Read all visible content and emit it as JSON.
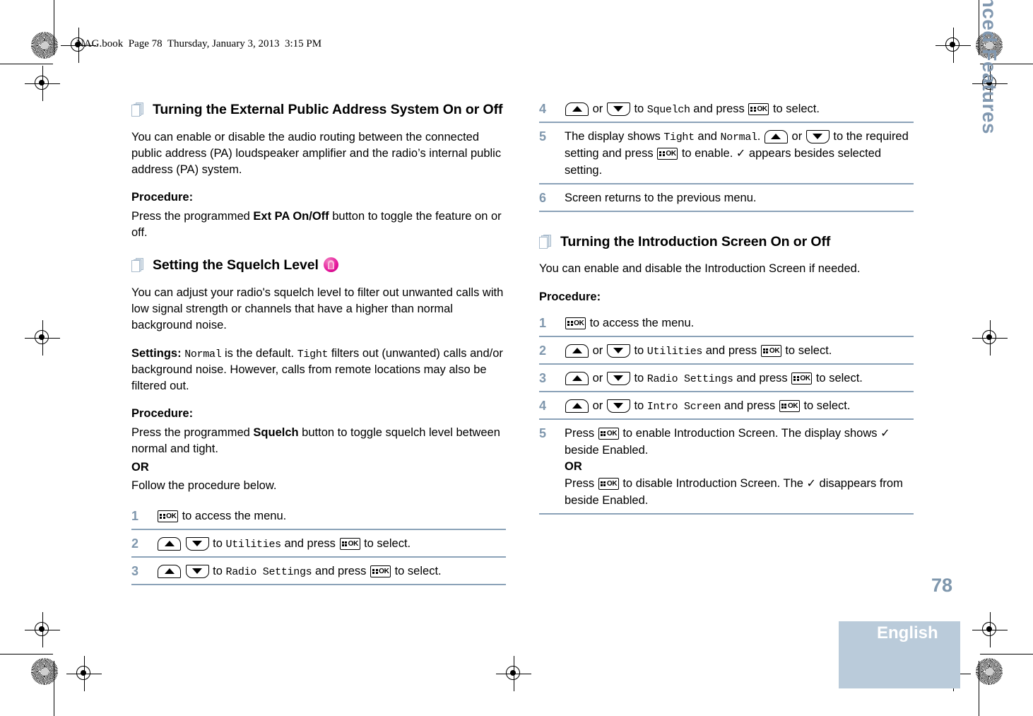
{
  "document": {
    "file_header": "NAG.book  Page 78  Thursday, January 3, 2013  3:15 PM",
    "page_number": "78",
    "language": "English",
    "chapter_tab": "Advanced Features"
  },
  "icons": {
    "pages": "pages-icon",
    "lock": "lock-icon",
    "ok_button": "ok-button-icon",
    "up_button": "up-arrow-button-icon",
    "down_button": "down-arrow-button-icon",
    "check": "✓"
  },
  "left_column": {
    "section1": {
      "heading": "Turning the External Public Address System On or Off",
      "intro": "You can enable or disable the audio routing between the connected public address (PA) loudspeaker amplifier and the radio’s internal public address (PA) system.",
      "procedure_label": "Procedure:",
      "procedure_pre": "Press the programmed ",
      "procedure_button": "Ext PA On/Off",
      "procedure_post": " button to toggle the feature on or off."
    },
    "section2": {
      "heading": "Setting the Squelch Level",
      "intro": "You can adjust your radio's squelch level to filter out unwanted calls with low signal strength or channels that have a higher than normal background noise.",
      "settings_label": "Settings:",
      "settings_t1": " ",
      "settings_mono1": "Normal",
      "settings_t2": " is the default. ",
      "settings_mono2": "Tight",
      "settings_t3": " filters out (unwanted) calls and/or background noise. However, calls from remote locations may also be filtered out.",
      "procedure_label": "Procedure:",
      "procedure_pre": "Press the programmed ",
      "procedure_button": "Squelch",
      "procedure_post": " button to toggle squelch level between normal and tight.",
      "or_label": "OR",
      "follow_text": "Follow the procedure below.",
      "steps": [
        {
          "num": "1",
          "pre": "",
          "post": " to access the menu.",
          "kind": "ok-then-text"
        },
        {
          "num": "2",
          "mid": " to ",
          "menu": "Utilities",
          "after": " and press ",
          "tail": " to select.",
          "kind": "arrows-menu-ok"
        },
        {
          "num": "3",
          "mid": " to ",
          "menu": "Radio Settings",
          "after": " and press ",
          "tail": " to select.",
          "kind": "arrows-menu-ok"
        }
      ],
      "or_word": "or"
    }
  },
  "right_column": {
    "continued_steps": [
      {
        "num": "4",
        "mid": " to ",
        "menu": "Squelch",
        "after": " and press ",
        "tail": " to select.",
        "kind": "arrows-menu-ok"
      },
      {
        "num": "5",
        "kind": "step5-display",
        "t1": "The display shows ",
        "m1": "Tight",
        "t2": " and ",
        "m2": "Normal",
        "t3": ". ",
        "t4": " to the required setting and press ",
        "t5": " to enable. ",
        "t6": " appears besides selected setting."
      },
      {
        "num": "6",
        "kind": "plain",
        "text": "Screen returns to the previous menu."
      }
    ],
    "section3": {
      "heading": "Turning the Introduction Screen On or Off",
      "intro": "You can enable and disable the Introduction Screen if needed.",
      "procedure_label": "Procedure:",
      "steps": [
        {
          "num": "1",
          "pre": "",
          "post": " to access the menu.",
          "kind": "ok-then-text"
        },
        {
          "num": "2",
          "mid": " to ",
          "menu": "Utilities",
          "after": " and press ",
          "tail": " to select.",
          "kind": "arrows-menu-ok"
        },
        {
          "num": "3",
          "mid": " to ",
          "menu": "Radio Settings",
          "after": " and press ",
          "tail": " to select.",
          "kind": "arrows-menu-ok"
        },
        {
          "num": "4",
          "mid": " to ",
          "menu": "Intro Screen",
          "after": " and press ",
          "tail": " to select.",
          "kind": "arrows-menu-ok"
        },
        {
          "num": "5",
          "kind": "step5-intro",
          "t1": "Press ",
          "t2": " to enable Introduction Screen. The display shows ",
          "t3": " beside Enabled.",
          "or_label": "OR",
          "t4": "Press ",
          "t5": " to disable Introduction Screen. The ",
          "t6": " disappears from beside Enabled."
        }
      ]
    },
    "or_word": "or"
  },
  "colors": {
    "accent_blue_gray": "#7f97ad",
    "rule_blue": "#8ba2b8",
    "language_band": "#bacbda",
    "lock_magenta": "#e5149a"
  }
}
